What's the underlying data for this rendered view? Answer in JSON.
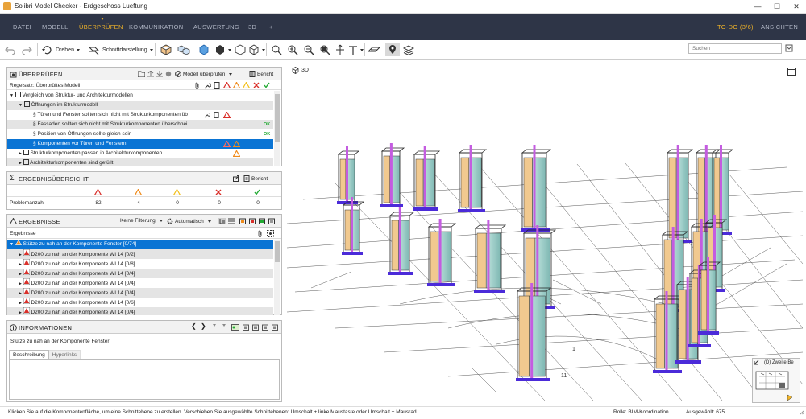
{
  "window": {
    "title": "Solibri Model Checker - Erdgeschoss Lueftung",
    "buttons": [
      "—",
      "☐",
      "✕"
    ]
  },
  "menu": {
    "items": [
      "DATEI",
      "MODELL",
      "ÜBERPRÜFEN",
      "KOMMUNIKATION",
      "AUSWERTUNG",
      "3D",
      "+"
    ],
    "active": "ÜBERPRÜFEN",
    "todo": "TO-DO (3/6)",
    "views": "ANSICHTEN"
  },
  "toolbar": {
    "rotate_label": "Drehen",
    "section_label": "Schnittdarstellung"
  },
  "search": {
    "placeholder": "Suchen"
  },
  "check_panel": {
    "title": "ÜBERPRÜFEN",
    "check_model_label": "Modell überprüfen",
    "report_label": "Bericht",
    "ruleset_label": "Regelsatz: Überprüftes Modell",
    "rows": [
      {
        "text": "Vergleich von Struktur- und Architekturmodellen"
      },
      {
        "text": "Öffnungen im Strukturmodell"
      },
      {
        "text": "Türen und Fenster sollten sich nicht mit Strukturkomponenten üb"
      },
      {
        "text": "Fassaden sollten sich nicht mit Strukturkomponenten überschnei",
        "status": "OK"
      },
      {
        "text": "Position von Öffnungen sollte gleich sein",
        "status": "OK"
      },
      {
        "text": "Komponenten vor Türen und Fenstern"
      },
      {
        "text": "Strukturkomponenten passen in Architekturkomponenten"
      },
      {
        "text": "Architekturkomponenten sind gefüllt"
      }
    ]
  },
  "summary_panel": {
    "title": "ERGEBNISÜBERSICHT",
    "report_label": "Bericht",
    "row_label": "Problemanzahl",
    "counts": [
      "82",
      "4",
      "0",
      "0",
      "0"
    ],
    "colors": [
      "#d9302a",
      "#ef8b1c",
      "#f2c01c",
      "#d9302a",
      "#22aa33"
    ]
  },
  "results_panel": {
    "title": "ERGEBNISSE",
    "filter_label": "Keine Filterung",
    "auto_label": "Automatisch",
    "column_label": "Ergebnisse",
    "rows": [
      "Stütze zu nah an der Komponente Fenster [0/74]",
      "D200 zu nah an der Komponente WI 14 [0/2]",
      "D200 zu nah an der Komponente WI 14 [0/8]",
      "D200 zu nah an der Komponente WI 14 [0/4]",
      "D200 zu nah an der Komponente WI 14 [0/4]",
      "D200 zu nah an der Komponente WI 14 [0/4]",
      "D200 zu nah an der Komponente WI 14 [0/6]",
      "D200 zu nah an der Komponente WI 14 [0/4]"
    ]
  },
  "info_panel": {
    "title": "INFORMATIONEN",
    "subtitle": "Stütze zu nah an der Komponente Fenster",
    "tabs": [
      "Beschreibung",
      "Hyperlinks"
    ]
  },
  "viewport": {
    "label": "3D",
    "minimap_label": "(D) Zweite Be",
    "axis_numbers": [
      "1",
      "11"
    ]
  },
  "status": {
    "hint": "Klicken Sie auf die Komponentenfläche, um eine Schnittebene zu erstellen. Verschieben Sie ausgewählte Schnittebenen: Umschalt + linke Maustaste oder Umschalt + Mausrad.",
    "role": "Rolle: BIM-Koordination",
    "selected": "Ausgewählt: 675"
  }
}
